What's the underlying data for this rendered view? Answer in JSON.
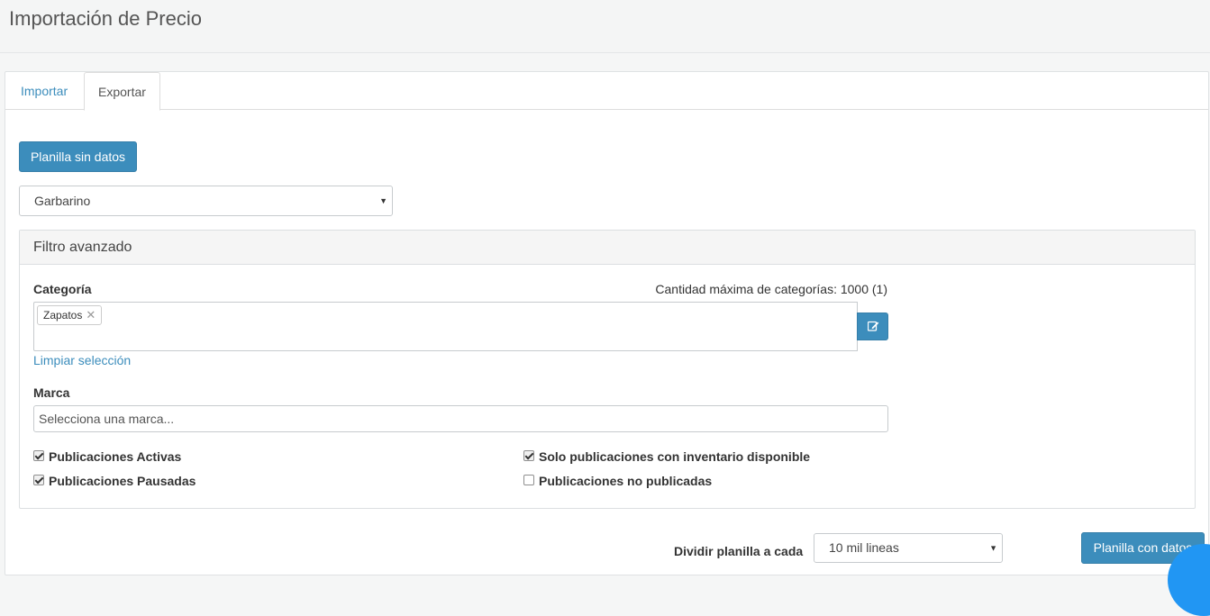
{
  "page": {
    "title": "Importación de Precio"
  },
  "tabs": [
    {
      "label": "Importar",
      "active": false
    },
    {
      "label": "Exportar",
      "active": true
    }
  ],
  "actions": {
    "empty_template_label": "Planilla sin datos",
    "data_template_label": "Planilla con datos"
  },
  "marketplace": {
    "selected": "Garbarino"
  },
  "filter": {
    "title": "Filtro avanzado",
    "category_label": "Categoría",
    "max_categories_text": "Cantidad máxima de categorías: 1000 (1)",
    "selected_tags": [
      "Zapatos"
    ],
    "clear_selection_label": "Limpiar selección",
    "brand_label": "Marca",
    "brand_placeholder": "Selecciona una marca...",
    "checks": {
      "active": {
        "label": "Publicaciones Activas",
        "checked": true
      },
      "paused": {
        "label": "Publicaciones Pausadas",
        "checked": true
      },
      "stock_only": {
        "label": "Solo publicaciones con inventario disponible",
        "checked": true
      },
      "unpublished": {
        "label": "Publicaciones no publicadas",
        "checked": false
      }
    }
  },
  "split": {
    "label": "Dividir planilla a cada",
    "selected": "10 mil lineas"
  },
  "colors": {
    "primary": "#3c8dbc",
    "help_bubble": "#2196f3"
  }
}
